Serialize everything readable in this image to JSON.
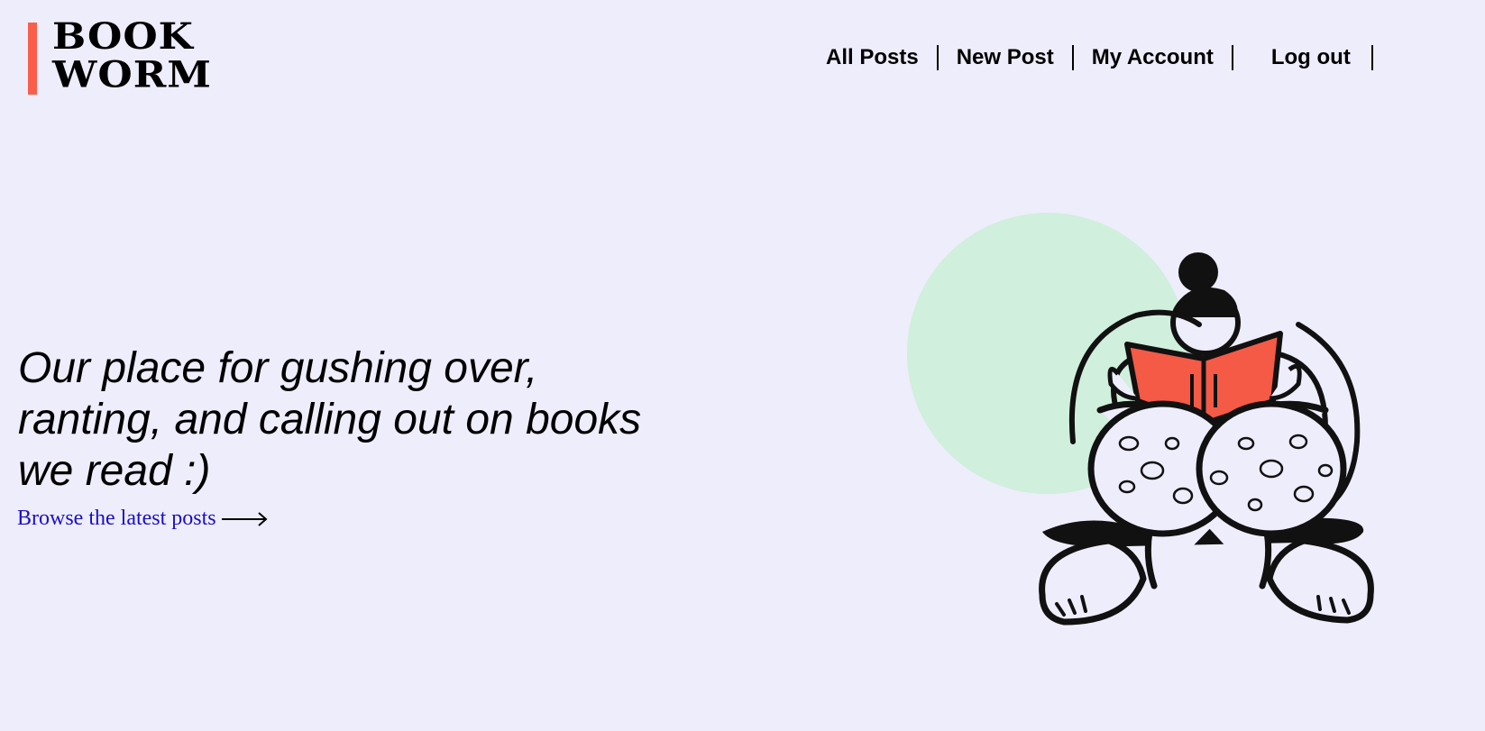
{
  "brand": {
    "name": "BOOK\nWORM",
    "accent_color": "#fa5e48"
  },
  "nav": {
    "items": [
      {
        "label": "All Posts"
      },
      {
        "label": "New Post"
      },
      {
        "label": "My Account"
      },
      {
        "label": "Log out"
      }
    ]
  },
  "hero": {
    "headline": "Our place for gushing over, ranting, and calling out on books we read :)",
    "browse_link": "Browse the latest posts",
    "arrow_icon": "long-right-arrow-icon"
  },
  "illustration": {
    "subject": "person-reading-book",
    "circle_color": "#d0efdc",
    "book_color": "#f45a46"
  }
}
